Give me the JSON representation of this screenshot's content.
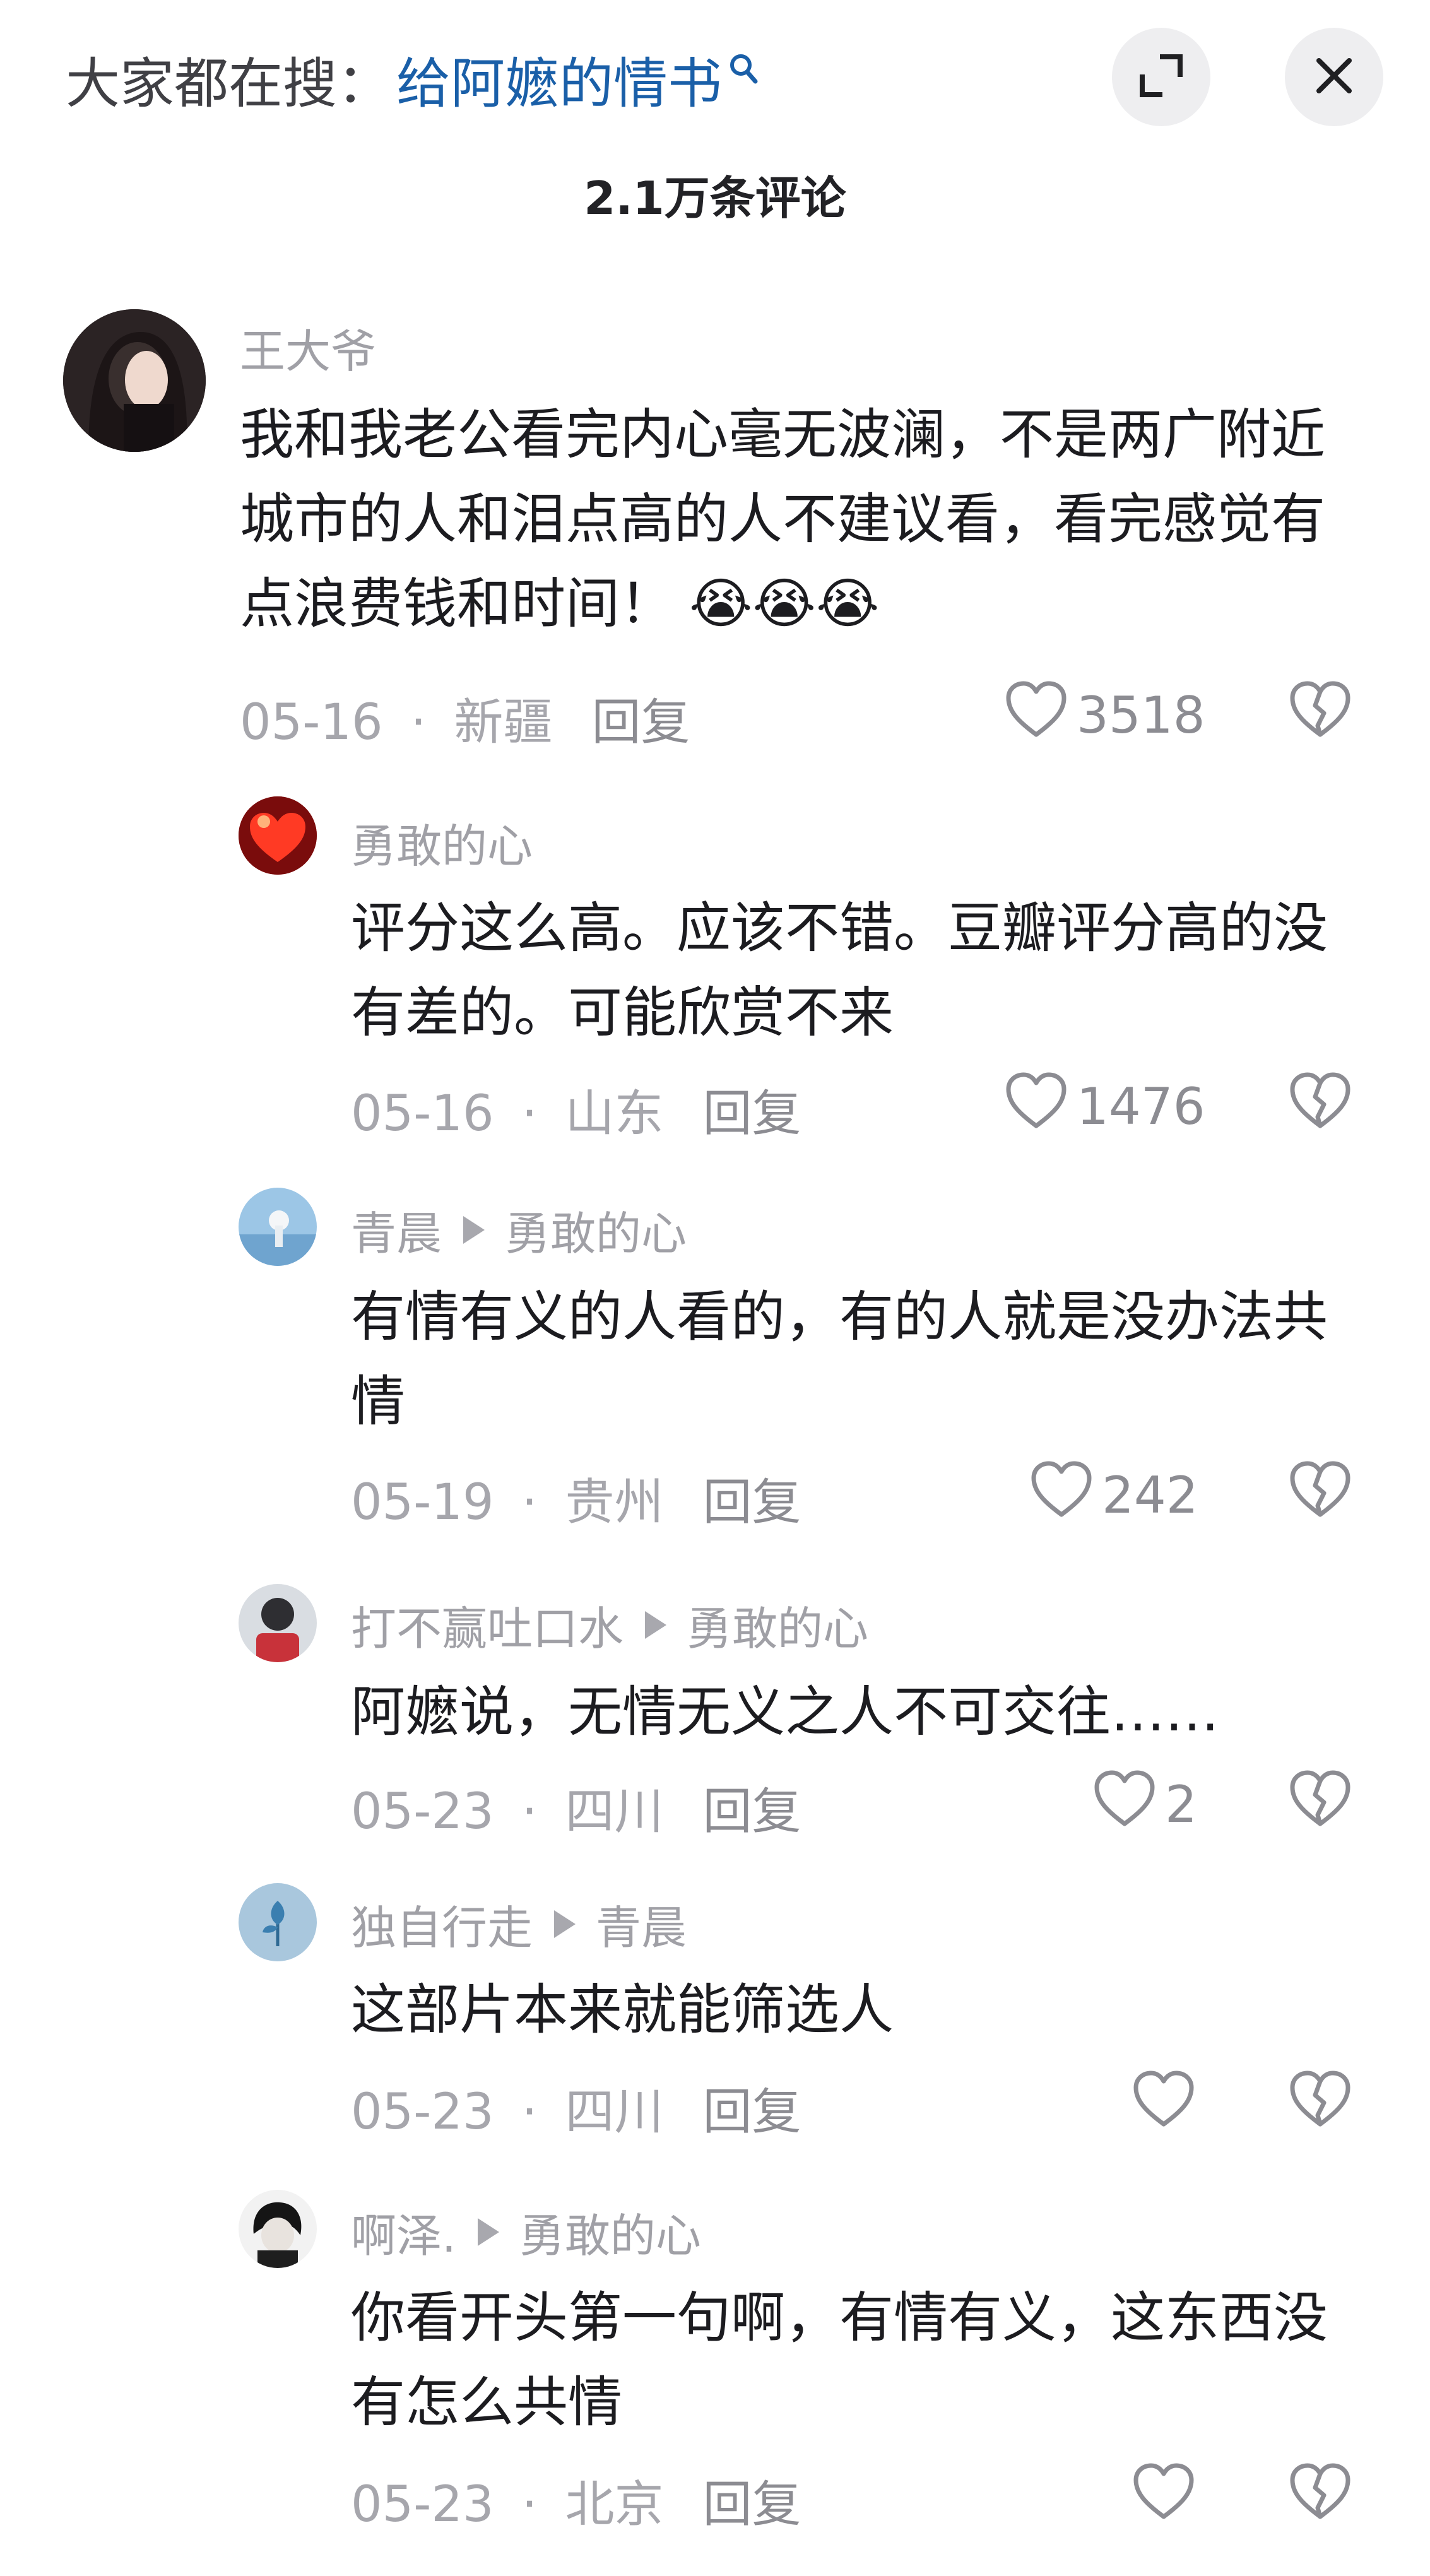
{
  "header": {
    "search_prefix": "大家都在搜：",
    "search_term": "给阿嬷的情书",
    "comment_count": "2.1万条评论"
  },
  "comments": [
    {
      "user": "王大爷",
      "text": "我和我老公看完内心毫无波澜，不是两广附近城市的人和泪点高的人不建议看，看完感觉有点浪费钱和时间！",
      "emoji": "😭😭😭",
      "date": "05-16",
      "location": "新疆",
      "reply_label": "回复",
      "likes": "3518"
    },
    {
      "user": "勇敢的心",
      "text": "评分这么高。应该不错。豆瓣评分高的没有差的。可能欣赏不来",
      "date": "05-16",
      "location": "山东",
      "reply_label": "回复",
      "likes": "1476"
    },
    {
      "user": "青晨",
      "reply_to": "勇敢的心",
      "text": "有情有义的人看的，有的人就是没办法共情",
      "date": "05-19",
      "location": "贵州",
      "reply_label": "回复",
      "likes": "242"
    },
    {
      "user": "打不赢吐口水",
      "reply_to": "勇敢的心",
      "text": "阿嬷说，无情无义之人不可交往……",
      "date": "05-23",
      "location": "四川",
      "reply_label": "回复",
      "likes": "2"
    },
    {
      "user": "独自行走",
      "reply_to": "青晨",
      "text": "这部片本来就能筛选人",
      "date": "05-23",
      "location": "四川",
      "reply_label": "回复",
      "likes": ""
    },
    {
      "user": "啊泽.",
      "reply_to": "勇敢的心",
      "text": "你看开头第一句啊，有情有义，这东西没有怎么共情",
      "date": "05-23",
      "location": "北京",
      "reply_label": "回复",
      "likes": ""
    }
  ],
  "icons": {
    "dot_separator": "·",
    "search": "search-icon",
    "expand": "expand-icon",
    "close": "close-icon",
    "like": "heart-icon",
    "dislike": "broken-heart-icon"
  }
}
